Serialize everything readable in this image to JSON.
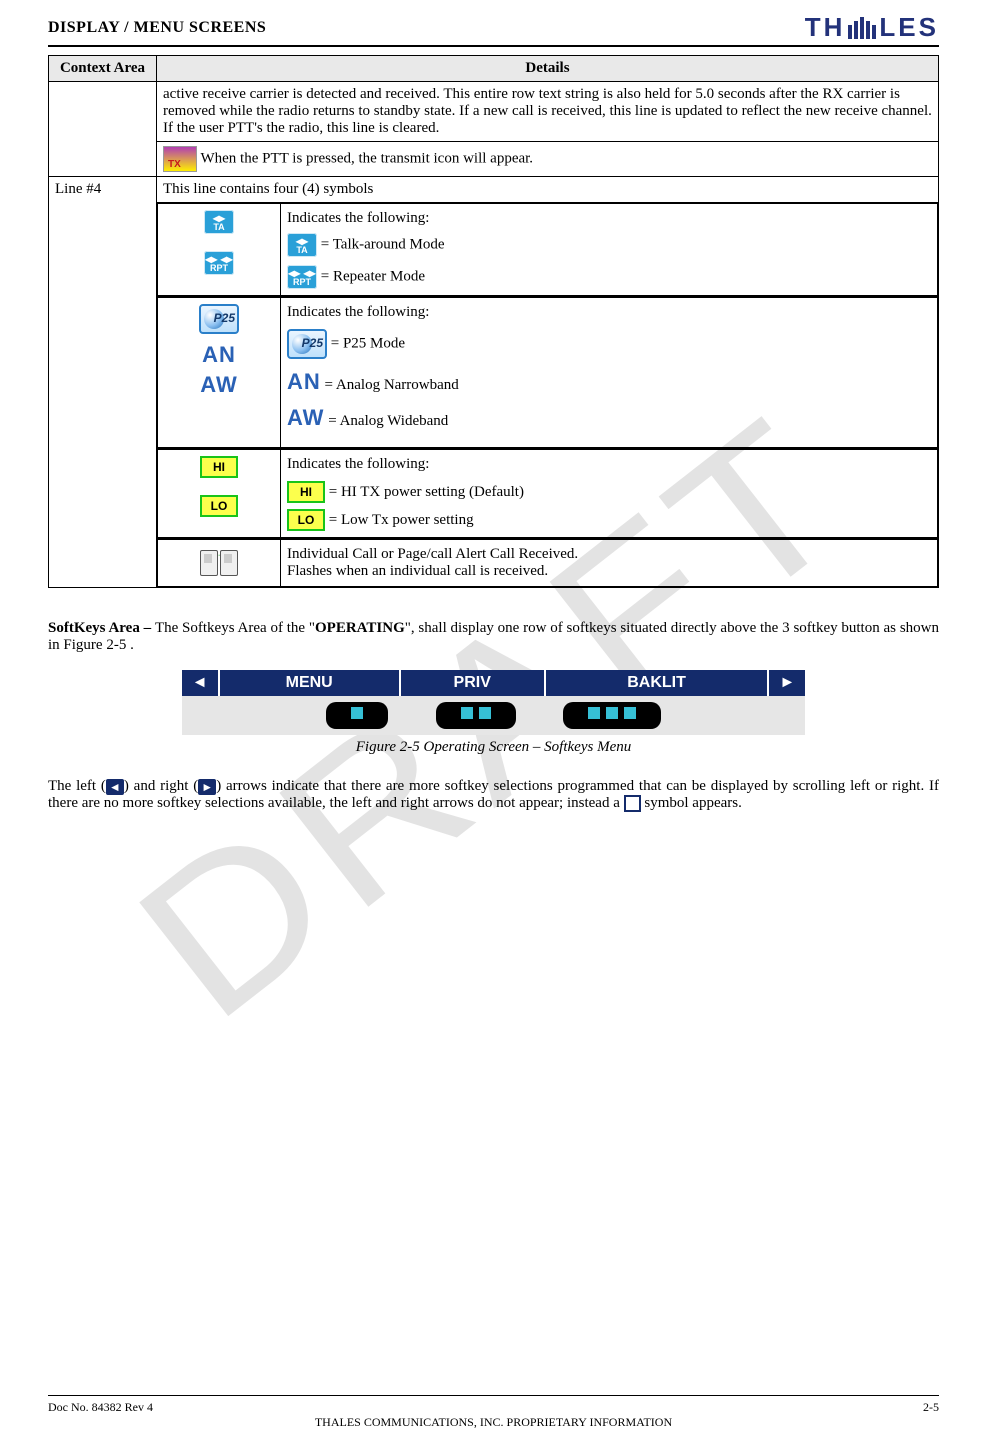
{
  "header": {
    "section": "DISPLAY / MENU SCREENS",
    "brand": "THALES"
  },
  "watermark": "DRAFT",
  "table": {
    "head": {
      "ctx": "Context Area",
      "det": "Details"
    },
    "r1_para": "active receive carrier is detected and received.  This entire row text string is also held for 5.0 seconds after the RX carrier is removed while the radio returns to standby state.  If a new call is received, this line is updated to reflect the new receive channel.  If the user PTT's the radio, this line is cleared.",
    "r1_tx": " When the PTT is pressed, the transmit icon will appear.",
    "line4_label": "Line #4",
    "line4_intro": "This line contains four (4) symbols",
    "grp1": {
      "lead": "Indicates the following:",
      "ta": " = Talk-around Mode",
      "rpt": " = Repeater Mode",
      "ta_abbr": "TA",
      "rpt_abbr": "RPT"
    },
    "grp2": {
      "lead": "Indicates the following:",
      "p25": " = P25 Mode",
      "an": " = Analog Narrowband",
      "aw": " = Analog Wideband",
      "p25_txt": "P25",
      "an_txt": "AN",
      "aw_txt": "AW"
    },
    "grp3": {
      "lead": "Indicates the following:",
      "hi": " = HI TX power setting (Default)",
      "lo": " = Low Tx power setting",
      "hi_lbl": "HI",
      "lo_lbl": "LO"
    },
    "grp4": {
      "l1": "Individual Call or Page/call Alert Call Received.",
      "l2": "Flashes when an individual call is received."
    }
  },
  "softkeys": {
    "para_lead": "SoftKeys Area – ",
    "para_mid1": "The Softkeys Area of the \"",
    "para_bold": "OPERATING",
    "para_mid2": "\", shall display one row of softkeys situated directly above the 3 softkey button as shown in Figure 2-5 .",
    "left": "◄",
    "menu": "MENU",
    "priv": "PRIV",
    "baklit": "BAKLIT",
    "right": "►",
    "caption": "Figure 2-5 Operating Screen – Softkeys Menu"
  },
  "para2": {
    "a": "The left (",
    "b": ") and right (",
    "c": ") arrows indicate that there are more softkey selections programmed that can be displayed by scrolling left or right.  If there are no more softkey selections available, the left and right arrows do not appear; instead a ",
    "d": " symbol appears."
  },
  "footer": {
    "doc": "Doc No. 84382 Rev 4",
    "mid": "THALES COMMUNICATIONS, INC. PROPRIETARY INFORMATION",
    "page": "2-5"
  }
}
